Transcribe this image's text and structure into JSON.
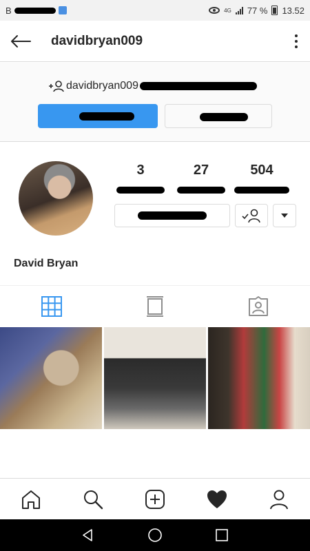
{
  "status_bar": {
    "carrier_initial": "B",
    "network": "4G",
    "battery_percent": "77 %",
    "time": "13.52"
  },
  "header": {
    "username": "davidbryan009"
  },
  "follow_request": {
    "text": "davidbryan009"
  },
  "profile": {
    "posts_count": "3",
    "followers_count": "27",
    "following_count": "504",
    "full_name": "David Bryan"
  },
  "tabs": [
    "grid-icon",
    "feed-icon",
    "tagged-icon"
  ],
  "bottom_nav": [
    "home-icon",
    "search-icon",
    "new-post-icon",
    "activity-icon",
    "profile-icon"
  ],
  "colors": {
    "accent_blue": "#3897f0",
    "border": "#dbdbdb",
    "text": "#262626"
  }
}
